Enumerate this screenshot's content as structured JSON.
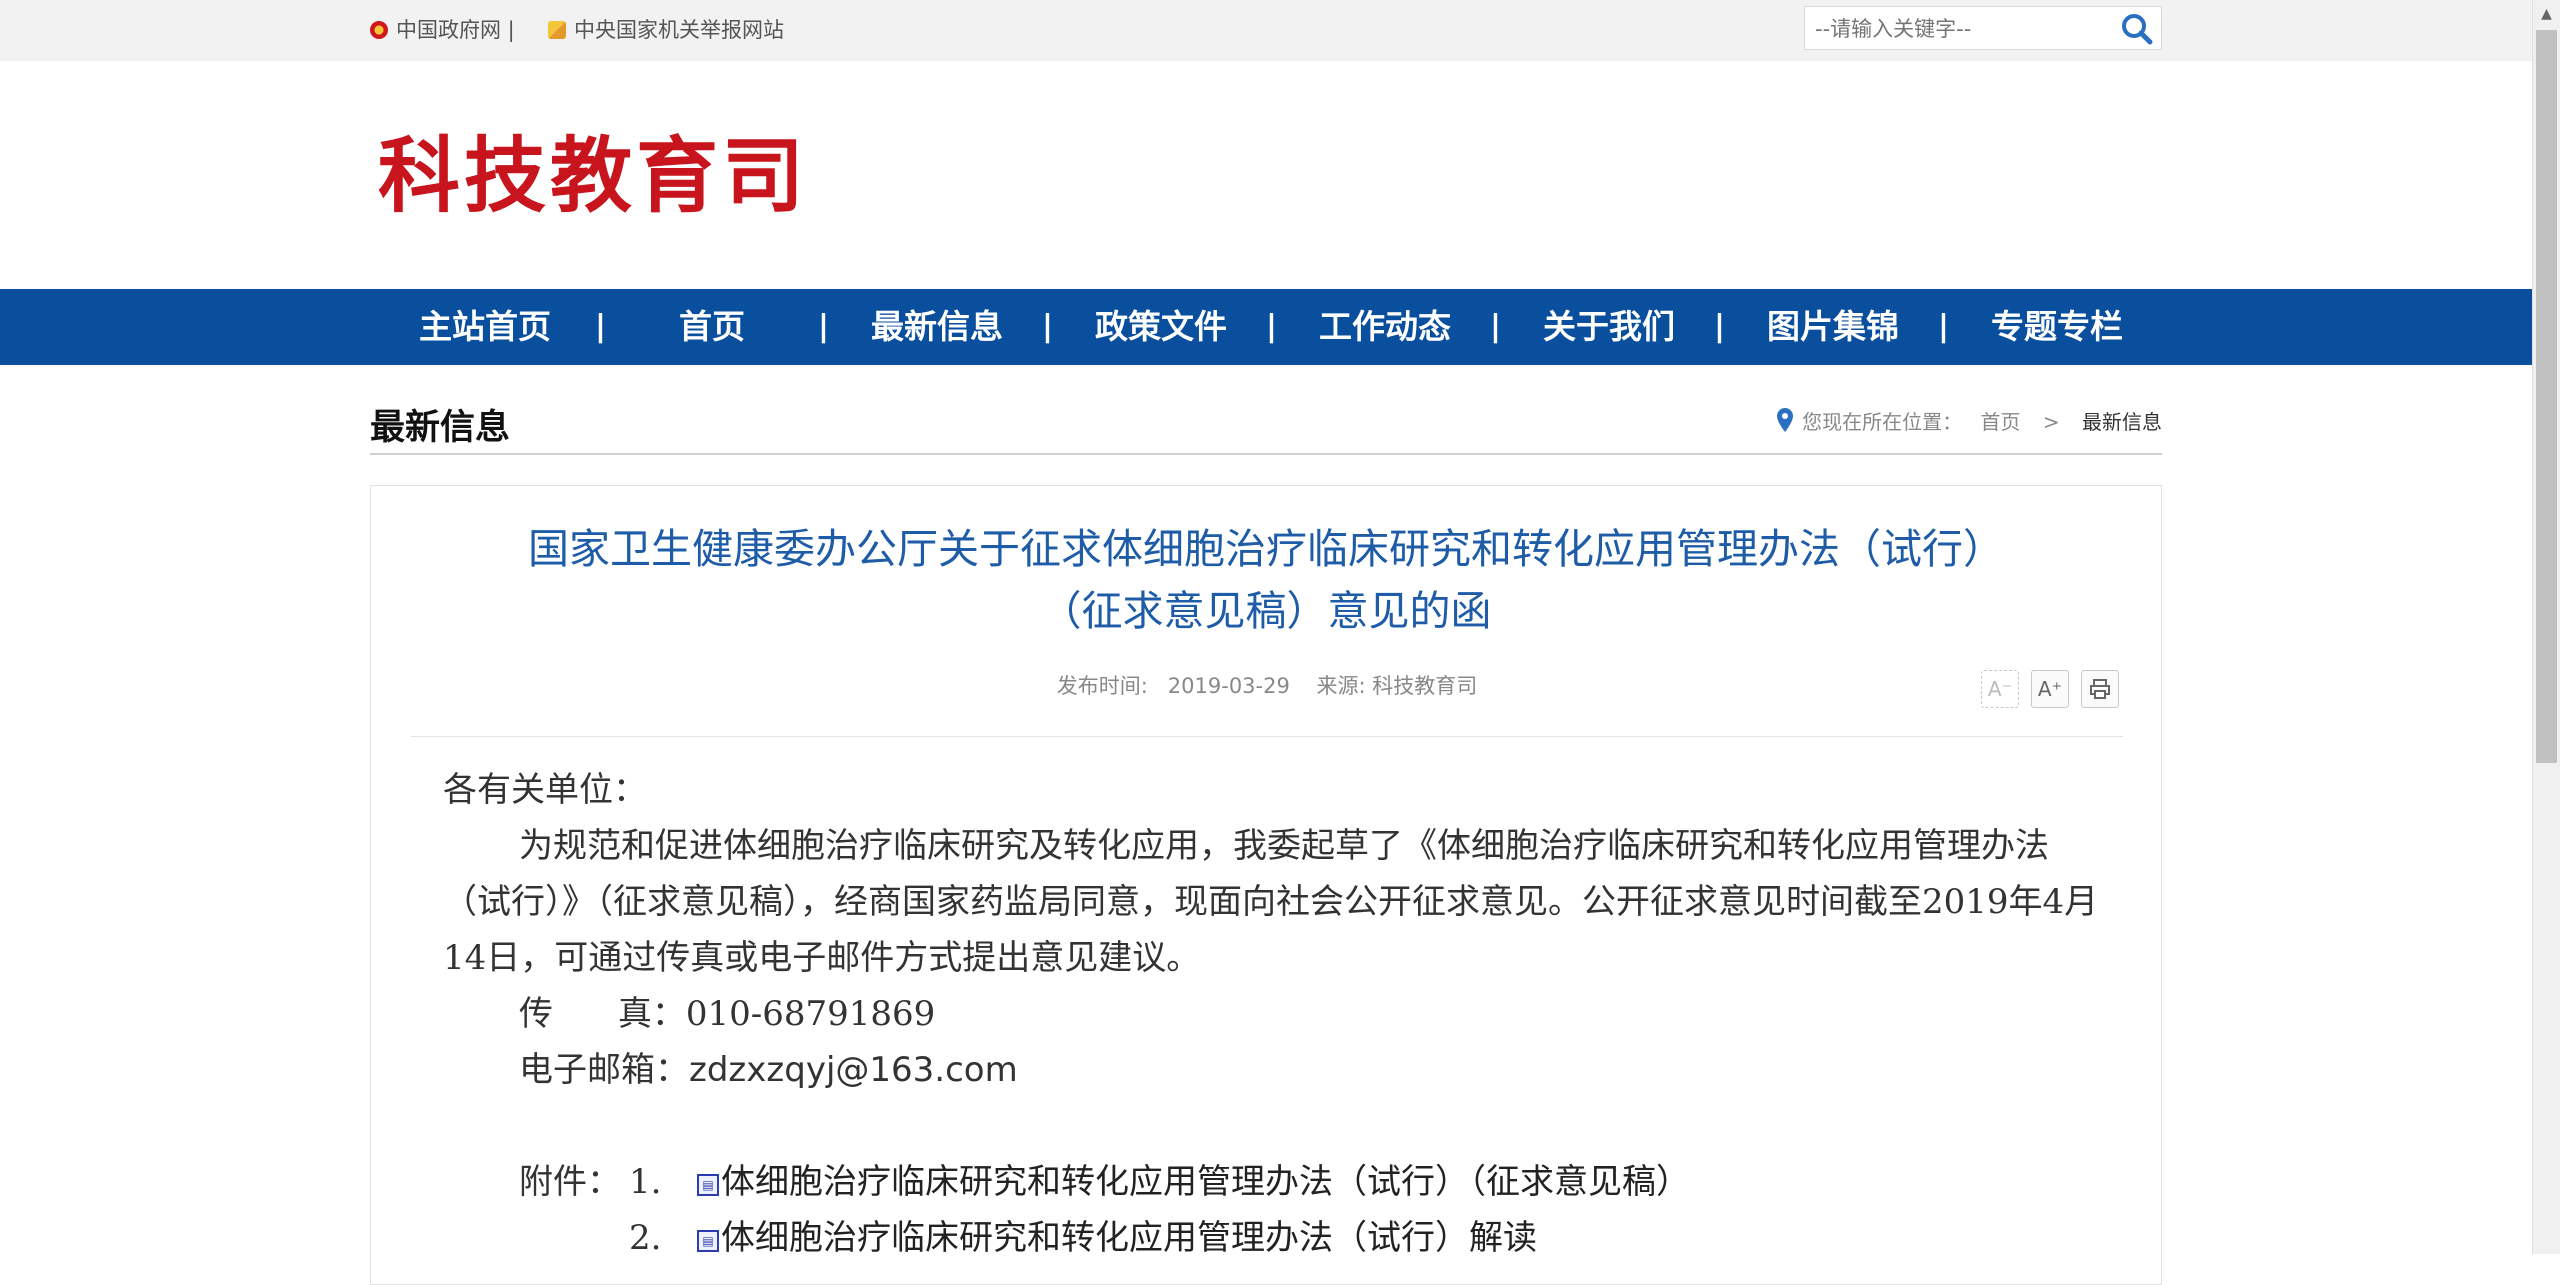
{
  "topbar": {
    "link1": "中国政府网 |",
    "link2": "中央国家机关举报网站",
    "search_placeholder": "--请输入关键字--"
  },
  "logo": "科技教育司",
  "nav": [
    "主站首页",
    "首页",
    "最新信息",
    "政策文件",
    "工作动态",
    "关于我们",
    "图片集锦",
    "专题专栏"
  ],
  "nav_separator": "|",
  "section": {
    "title": "最新信息",
    "breadcrumb_prefix": "您现在所在位置：",
    "breadcrumb_home": "首页",
    "breadcrumb_sep": ">",
    "breadcrumb_current": "最新信息"
  },
  "article": {
    "title_line1": "国家卫生健康委办公厅关于征求体细胞治疗临床研究和转化应用管理办法（试行）",
    "title_line2": "（征求意见稿）意见的函",
    "meta": "发布时间:   2019-03-29    来源: 科技教育司",
    "tools": {
      "font_smaller": "A⁻",
      "font_larger": "A⁺"
    },
    "salutation": "各有关单位：",
    "paragraph": "为规范和促进体细胞治疗临床研究及转化应用，我委起草了《体细胞治疗临床研究和转化应用管理办法（试行）》（征求意见稿），经商国家药监局同意，现面向社会公开征求意见。公开征求意见时间截至2019年4月14日，可通过传真或电子邮件方式提出意见建议。",
    "fax_label": "传      真：",
    "fax": "010-68791869",
    "email_label": "电子邮箱：",
    "email": "zdzxzqyj@163.com",
    "attachment_label": "附件：",
    "attachments": [
      {
        "num": "1.",
        "title": "体细胞治疗临床研究和转化应用管理办法（试行）（征求意见稿）"
      },
      {
        "num": "2.",
        "title": "体细胞治疗临床研究和转化应用管理办法（试行）解读"
      }
    ]
  },
  "colors": {
    "nav_bg": "#0a4f9e",
    "logo_red": "#c8141c",
    "title_blue": "#1e5ca8"
  },
  "icons": [
    "gov-emblem-icon",
    "report-icon",
    "search-icon",
    "location-pin-icon",
    "font-smaller-icon",
    "font-larger-icon",
    "print-icon",
    "file-icon"
  ]
}
